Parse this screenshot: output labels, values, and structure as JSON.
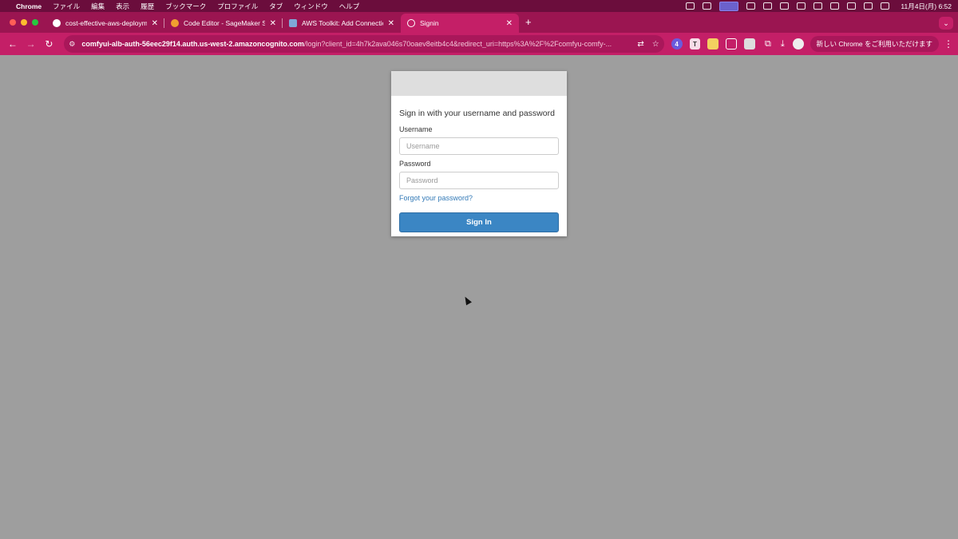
{
  "menubar": {
    "app_name": "Chrome",
    "items": [
      "ファイル",
      "編集",
      "表示",
      "履歴",
      "ブックマーク",
      "プロファイル",
      "タブ",
      "ウィンドウ",
      "ヘルプ"
    ],
    "clock": "11月4日(月)  6:52"
  },
  "tabs": [
    {
      "title": "cost-effective-aws-deployme",
      "icon": "github-icon"
    },
    {
      "title": "Code Editor - SageMaker Stu",
      "icon": "sagemaker-icon"
    },
    {
      "title": "AWS Toolkit: Add Connection",
      "icon": "aws-toolkit-icon"
    },
    {
      "title": "Signin",
      "icon": "globe-icon",
      "active": true
    }
  ],
  "toolbar": {
    "url_host": "comfyui-alb-auth-56eec29f14.auth.us-west-2.amazoncognito.com",
    "url_path": "/login?client_id=4h7k2ava046s70oaev8eitb4c4&redirect_uri=https%3A%2F%2Fcomfyu-comfy-...",
    "extension_badge": "4",
    "update_label": "新しい Chrome をご利用いただけます"
  },
  "signin": {
    "title": "Sign in with your username and password",
    "username_label": "Username",
    "username_placeholder": "Username",
    "password_label": "Password",
    "password_placeholder": "Password",
    "forgot_link": "Forgot your password?",
    "submit_label": "Sign In"
  },
  "colors": {
    "menubar": "#6b0d3c",
    "tabstrip": "#9b1551",
    "toolbar": "#c41f67",
    "page_bg": "#9e9e9e",
    "button": "#3b86c4",
    "link": "#337ab7"
  }
}
